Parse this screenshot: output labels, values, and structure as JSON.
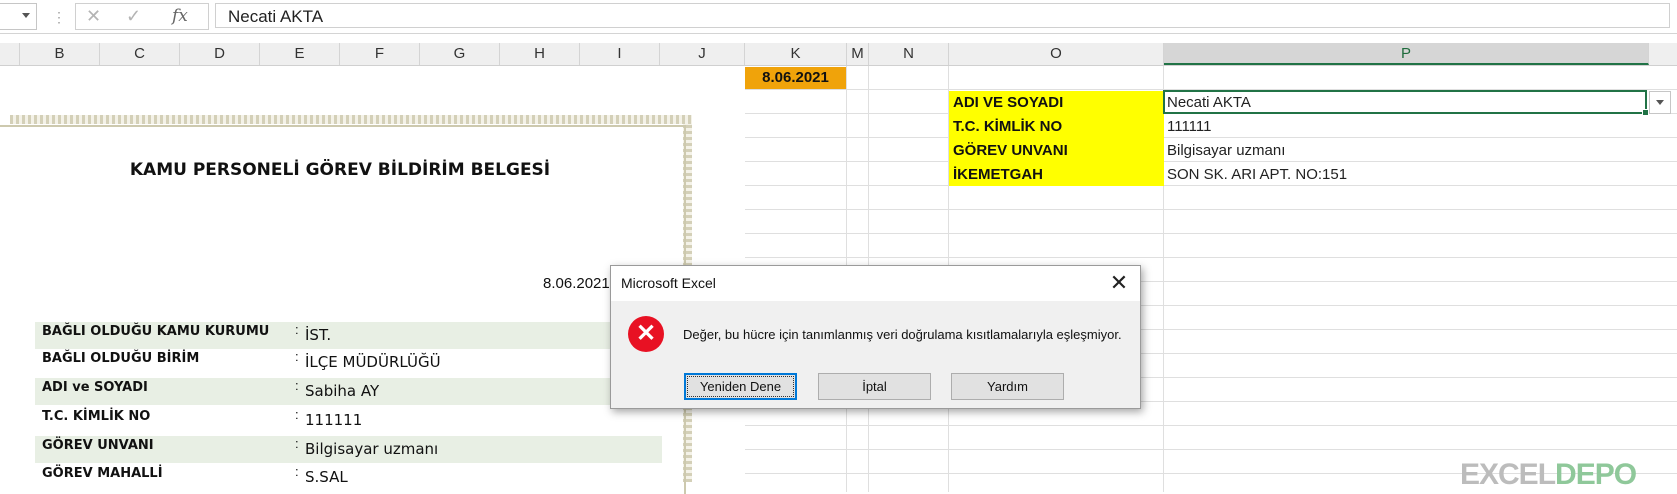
{
  "formula_bar": {
    "cancel_icon": "x-icon",
    "enter_icon": "check-icon",
    "fx_label": "fx",
    "value": "Necati AKTA"
  },
  "columns": [
    "B",
    "C",
    "D",
    "E",
    "F",
    "G",
    "H",
    "I",
    "J",
    "K",
    "M",
    "N",
    "O",
    "P"
  ],
  "selected_column": "P",
  "date_cell": "8.06.2021",
  "info": {
    "labels": [
      "ADI VE SOYADI",
      "T.C. KİMLİK NO",
      "GÖREV UNVANI",
      "İKEMETGAH"
    ],
    "values": [
      "Necati AKTA",
      "111111",
      "Bilgisayar uzmanı",
      "SON SK. ARI APT. NO:151"
    ]
  },
  "form": {
    "title": "KAMU PERSONELİ GÖREV BİLDİRİM BELGESİ",
    "date": "8.06.2021",
    "colon": ":",
    "rows": [
      {
        "label": "BAĞLI OLDUĞU KAMU KURUMU",
        "value": "İST."
      },
      {
        "label": "BAĞLI OLDUĞU BİRİM",
        "value": "İLÇE MÜDÜRLÜĞÜ"
      },
      {
        "label": "ADI ve SOYADI",
        "value": "Sabiha AY"
      },
      {
        "label": "T.C. KİMLİK NO",
        "value": "111111"
      },
      {
        "label": "GÖREV UNVANI",
        "value": "Bilgisayar uzmanı"
      },
      {
        "label": "GÖREV MAHALLİ",
        "value": "S.SAL"
      }
    ]
  },
  "dialog": {
    "title": "Microsoft Excel",
    "message": "Değer, bu hücre için tanımlanmış veri doğrulama kısıtlamalarıyla eşleşmiyor.",
    "icon": "error-icon",
    "buttons": [
      "Yeniden Dene",
      "İptal",
      "Yardım"
    ]
  },
  "watermark": {
    "text_a": "EXCEL",
    "text_b": "DEPO"
  }
}
